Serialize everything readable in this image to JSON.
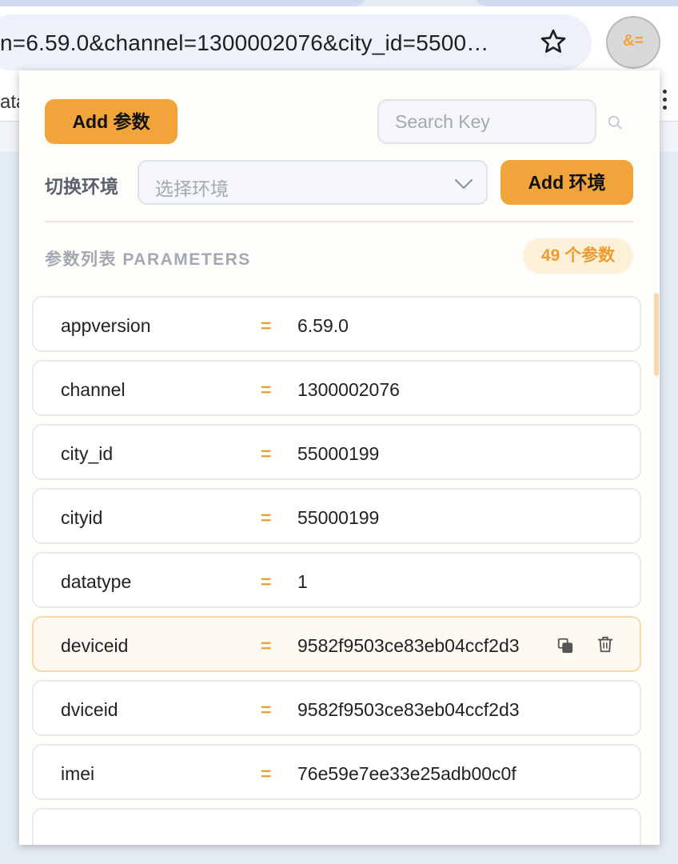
{
  "browser": {
    "url_visible": "n=6.59.0&channel=1300002076&city_id=5500…",
    "bookmark_text": "ata",
    "extension_icon": "&="
  },
  "popup": {
    "add_param_label": "Add 参数",
    "search_placeholder": "Search Key",
    "env_label": "切换环境",
    "env_select_placeholder": "选择环境",
    "add_env_label": "Add 环境",
    "section_title": "参数列表 PARAMETERS",
    "count_badge": "49 个参数",
    "eq_symbol": "=",
    "params": [
      {
        "key": "appversion",
        "value": "6.59.0"
      },
      {
        "key": "channel",
        "value": "1300002076"
      },
      {
        "key": "city_id",
        "value": "55000199"
      },
      {
        "key": "cityid",
        "value": "55000199"
      },
      {
        "key": "datatype",
        "value": "1"
      },
      {
        "key": "deviceid",
        "value": "9582f9503ce83eb04ccf2d3",
        "hovered": true
      },
      {
        "key": "dviceid",
        "value": "9582f9503ce83eb04ccf2d3"
      },
      {
        "key": "imei",
        "value": "76e59e7ee33e25adb00c0f"
      },
      {
        "key": "",
        "value": ""
      }
    ]
  },
  "colors": {
    "accent": "#f0a43a",
    "badge_bg": "#fdf0d9",
    "hover_row_bg": "#fefaf1"
  }
}
